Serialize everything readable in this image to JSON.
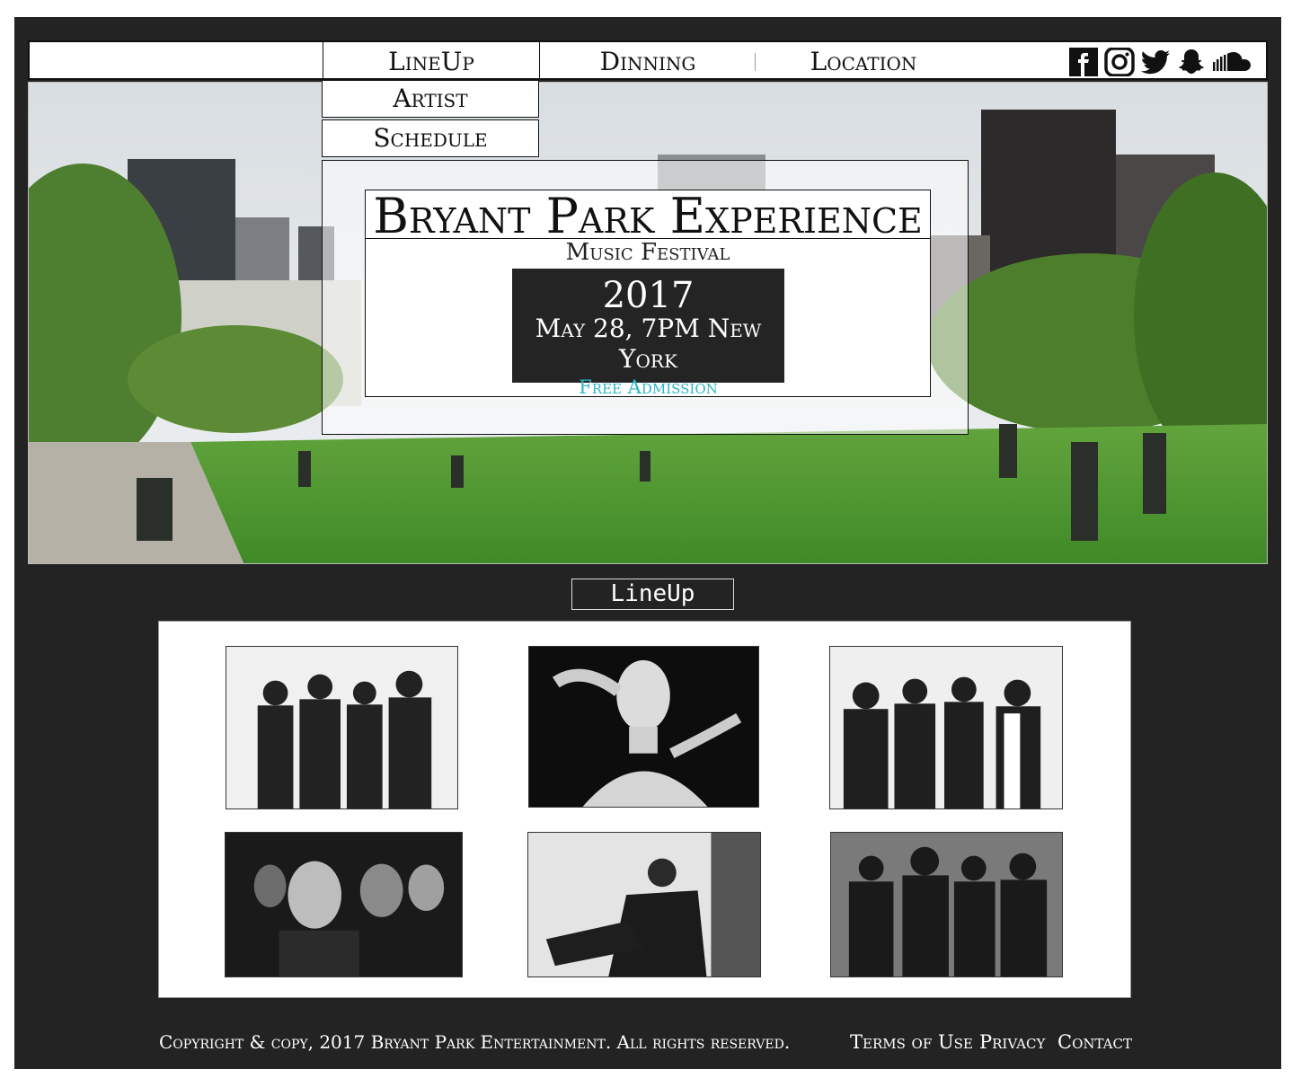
{
  "nav": {
    "lineup": "LineUp",
    "dinning": "Dinning",
    "location": "Location",
    "dropdown": [
      "Artist",
      "Schedule"
    ]
  },
  "social_icons": [
    "facebook-icon",
    "instagram-icon",
    "twitter-icon",
    "snapchat-icon",
    "soundcloud-icon"
  ],
  "hero": {
    "title": "Bryant Park Experience",
    "subtitle": "Music Festival",
    "year": "2017",
    "date": "May 28, 7PM New York",
    "admission": "Free Admission"
  },
  "lineup": {
    "label": "LineUp",
    "artists_count": 6
  },
  "footer": {
    "copyright": "Copyright & copy, 2017 Bryant Park Entertainment. All rights reserved.",
    "terms": "Terms of Use",
    "privacy": "Privacy",
    "contact": "Contact"
  },
  "colors": {
    "background": "#232323",
    "accent": "#2db6c8",
    "panel": "#ffffff"
  }
}
